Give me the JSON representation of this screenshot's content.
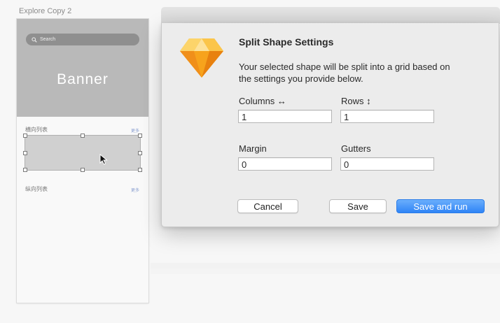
{
  "canvas": {
    "artboard_name": "Explore Copy 2"
  },
  "artboard": {
    "search_placeholder": "Search",
    "banner_title": "Banner",
    "section1_label": "横向列表",
    "section1_more": "更多",
    "section2_label": "纵向列表",
    "section2_more": "更多"
  },
  "dialog": {
    "title": "Split Shape Settings",
    "message": "Your selected shape will be split into a grid based on the settings you provide below.",
    "fields": {
      "columns_label": "Columns ↔",
      "columns_value": "1",
      "rows_label": "Rows ↕",
      "rows_value": "1",
      "margin_label": "Margin",
      "margin_value": "0",
      "gutters_label": "Gutters",
      "gutters_value": "0"
    },
    "buttons": {
      "cancel": "Cancel",
      "save": "Save",
      "save_and_run": "Save and run"
    }
  },
  "colors": {
    "primary_button": "#2f84f6",
    "banner_gray": "#b9b9b9",
    "sketch_logo": "#f7a31c"
  },
  "icons": {
    "app_icon": "sketch-diamond-icon",
    "search_icon": "magnifier-icon",
    "cursor": "mouse-pointer-icon"
  }
}
